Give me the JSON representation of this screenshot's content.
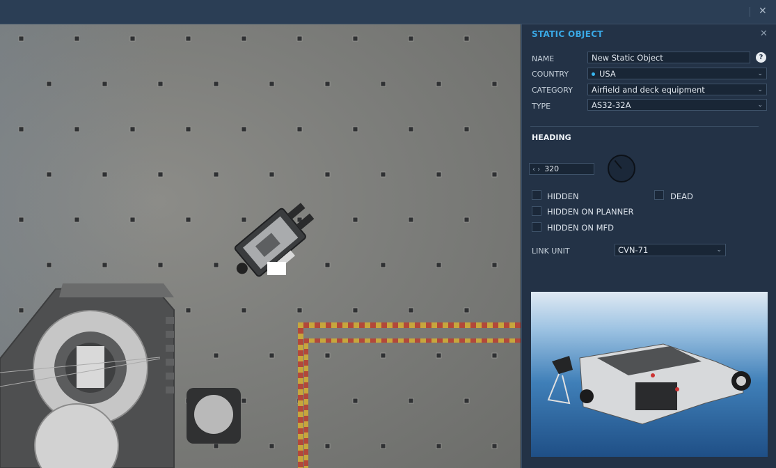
{
  "window": {
    "close_icon": "close-icon"
  },
  "panel": {
    "title": "STATIC OBJECT",
    "fields": {
      "name_label": "NAME",
      "name_value": "New Static Object",
      "country_label": "COUNTRY",
      "country_value": "USA",
      "category_label": "CATEGORY",
      "category_value": "Airfield and deck equipment",
      "type_label": "TYPE",
      "type_value": "AS32-32A"
    },
    "help_label": "?",
    "heading": {
      "section_label": "HEADING",
      "value": "320",
      "degrees": 320
    },
    "checkboxes": {
      "hidden": "HIDDEN",
      "dead": "DEAD",
      "hidden_on_planner": "HIDDEN ON PLANNER",
      "hidden_on_mfd": "HIDDEN ON MFD"
    },
    "link_unit": {
      "label": "LINK UNIT",
      "value": "CVN-71"
    },
    "colors": {
      "accent": "#3aa9e6",
      "panel_bg": "#233246",
      "country_dot": "#38b6f0"
    }
  }
}
